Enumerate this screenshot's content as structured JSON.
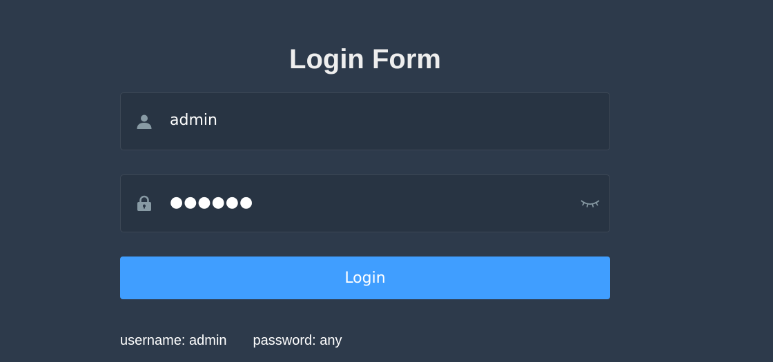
{
  "title": "Login Form",
  "username": {
    "value": "admin",
    "icon": "user-icon"
  },
  "password": {
    "value": "●●●●●●",
    "icon": "lock-icon",
    "toggle_icon": "eye-closed-icon"
  },
  "login_button": {
    "label": "Login"
  },
  "tips": {
    "username": "username: admin",
    "password": "password: any"
  },
  "colors": {
    "background": "#2d3a4b",
    "input_background": "#283443",
    "button": "#409eff",
    "icon": "#889aa4",
    "text": "#ffffff",
    "title": "#eeeeee"
  }
}
